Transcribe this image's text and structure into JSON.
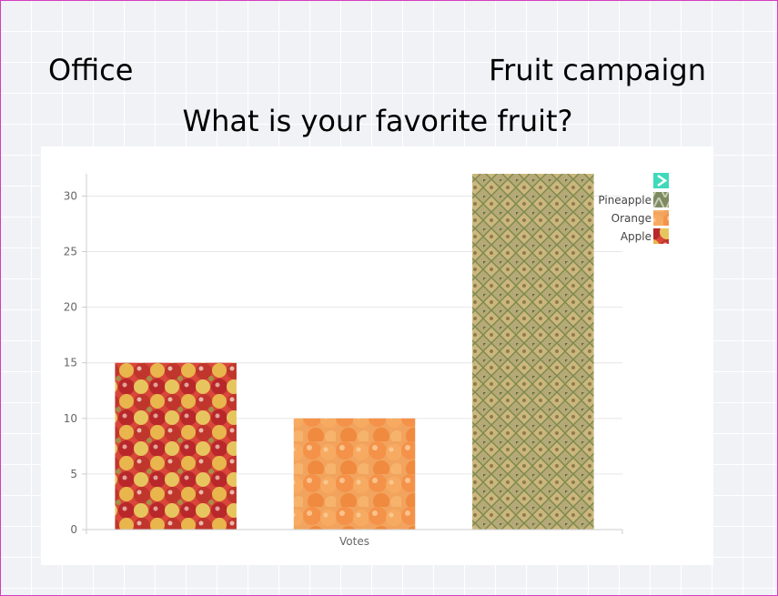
{
  "header": {
    "left_title": "Office",
    "right_title": "Fruit campaign",
    "question": "What is your favorite fruit?"
  },
  "chart_data": {
    "type": "bar",
    "categories": [
      "Votes"
    ],
    "series": [
      {
        "name": "Apple",
        "values": [
          15
        ],
        "fill": "apple-photo"
      },
      {
        "name": "Orange",
        "values": [
          10
        ],
        "fill": "orange-photo"
      },
      {
        "name": "Pineapple",
        "values": [
          32
        ],
        "fill": "pineapple-photo"
      }
    ],
    "xlabel": "Votes",
    "ylabel": "",
    "ylim": [
      0,
      32
    ],
    "yticks": [
      0,
      5,
      10,
      15,
      20,
      25,
      30
    ],
    "grid": true,
    "legend": {
      "position": "top-right",
      "order": [
        "Pineapple",
        "Orange",
        "Apple"
      ],
      "toggle_icon": "chevron-right-icon",
      "toggle_color": "#3fd9bb"
    }
  },
  "colors": {
    "frame_border": "#d63cc0",
    "background": "#f1f2f6",
    "gridline": "#e6e6e6",
    "axis_text": "#666666"
  }
}
